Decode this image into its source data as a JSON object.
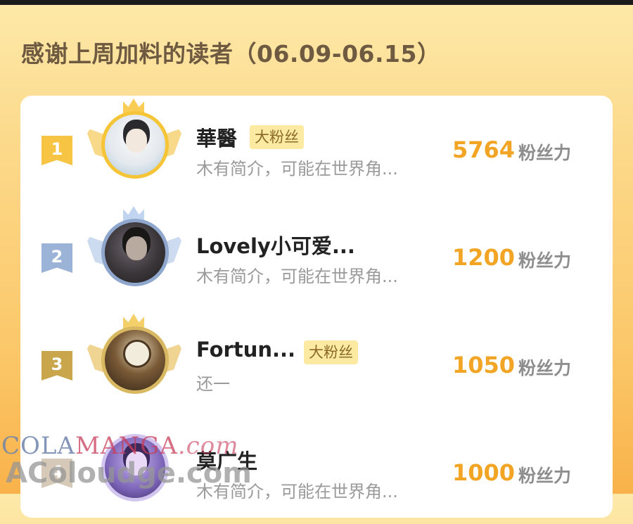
{
  "title": "感谢上周加料的读者（06.09-06.15）",
  "score_unit": "粉丝力",
  "readers": [
    {
      "rank": "1",
      "name": "華醫",
      "badge": "大粉丝",
      "bio": "木有简介，可能在世界角...",
      "score": "5764"
    },
    {
      "rank": "2",
      "name": "Lovely小可爱...",
      "badge": "",
      "bio": "木有简介，可能在世界角...",
      "score": "1200"
    },
    {
      "rank": "3",
      "name": "Fortun...",
      "badge": "大粉丝",
      "bio": "还一",
      "score": "1050"
    },
    {
      "rank": "4",
      "name": "莫广生",
      "badge": "",
      "bio": "木有简介，可能在世界角...",
      "score": "1000"
    }
  ],
  "watermark": {
    "part1": "COLA",
    "part2": "MANGA",
    "part3": ".com",
    "line2": "AColoudge.com"
  },
  "colors": {
    "score": "#f2a524",
    "badge_bg": "#fdeaa2",
    "rank_gold": "#f7c443",
    "rank_silver": "#9bb3d7",
    "rank_bronze": "#c9a64c"
  }
}
